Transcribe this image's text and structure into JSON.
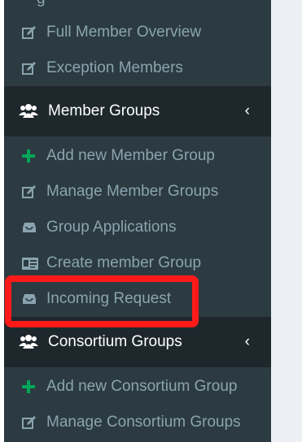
{
  "sidebar": {
    "cutoff_text": "g",
    "items": [
      {
        "label": "Full Member Overview",
        "icon": "edit-icon",
        "type": "sub"
      },
      {
        "label": "Exception Members",
        "icon": "edit-icon",
        "type": "sub"
      },
      {
        "label": "Member Groups",
        "icon": "users-icon",
        "type": "header",
        "chevron": "‹"
      },
      {
        "label": "Add new Member Group",
        "icon": "plus-icon",
        "type": "sub"
      },
      {
        "label": "Manage Member Groups",
        "icon": "edit-icon",
        "type": "sub"
      },
      {
        "label": "Group Applications",
        "icon": "inbox-icon",
        "type": "sub"
      },
      {
        "label": "Create member Group",
        "icon": "id-card-icon",
        "type": "sub"
      },
      {
        "label": "Incoming Request",
        "icon": "inbox-icon",
        "type": "sub"
      },
      {
        "label": "Consortium Groups",
        "icon": "users-icon",
        "type": "header",
        "chevron": "‹"
      },
      {
        "label": "Add new Consortium Group",
        "icon": "plus-icon",
        "type": "sub"
      },
      {
        "label": "Manage Consortium Groups",
        "icon": "edit-icon",
        "type": "sub"
      }
    ]
  },
  "colors": {
    "sidebar_bg": "#2c3b41",
    "header_bg": "#1e282c",
    "text_muted": "#8aa4af",
    "plus_green": "#00a65a",
    "highlight": "#ff1a1a",
    "content_bg": "#ecf0f5"
  }
}
